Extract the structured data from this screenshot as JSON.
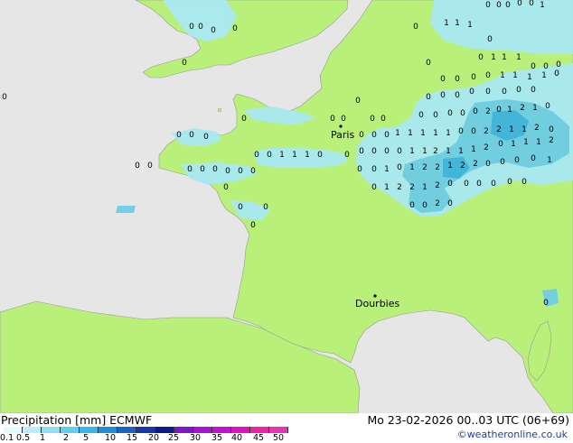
{
  "map": {
    "colors": {
      "sea": "#e6e6e6",
      "land": "#b8f07a",
      "precip_light": "#a8e8f5",
      "precip_med": "#6ccce8",
      "precip_heavy": "#3ab0e0",
      "coast": "#9a9a9a"
    },
    "cities": [
      {
        "name": "Paris"
      },
      {
        "name": "Dourbies"
      }
    ],
    "value_labels": [
      "0",
      "1",
      "2"
    ]
  },
  "legend": {
    "title": "Precipitation [mm]  ECMWF",
    "colors": [
      "#e6fafd",
      "#b9eef8",
      "#8de0f4",
      "#5fcfee",
      "#35b8e8",
      "#1f8fd8",
      "#1a62c4",
      "#1538a8",
      "#0a1c8a",
      "#7d18c8",
      "#a312d6",
      "#c40fd0",
      "#e010c0",
      "#f020a8",
      "#e830b8"
    ],
    "ticks": [
      "0.1",
      "0.5",
      "1",
      "2",
      "5",
      "10",
      "15",
      "20",
      "25",
      "30",
      "35",
      "40",
      "45",
      "50"
    ]
  },
  "footer": {
    "datetime": "Mo 23-02-2026 00..03 UTC (06+69)",
    "credit": "©weatheronline.co.uk"
  }
}
